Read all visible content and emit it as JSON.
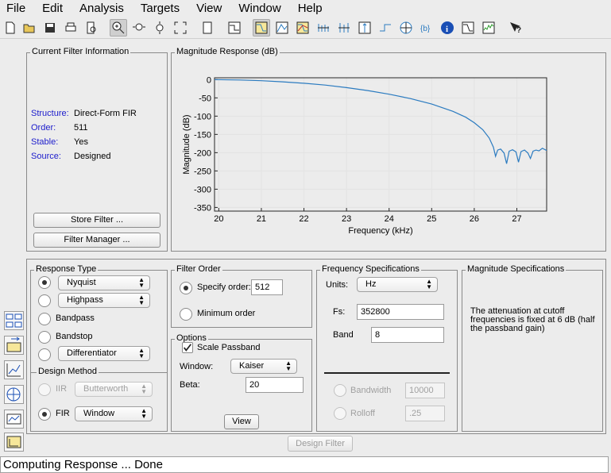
{
  "menubar": {
    "items": [
      "File",
      "Edit",
      "Analysis",
      "Targets",
      "View",
      "Window",
      "Help"
    ]
  },
  "current_filter": {
    "title": "Current Filter Information",
    "structure_label": "Structure:",
    "structure_value": "Direct-Form FIR",
    "order_label": "Order:",
    "order_value": "511",
    "stable_label": "Stable:",
    "stable_value": "Yes",
    "source_label": "Source:",
    "source_value": "Designed",
    "store_button": "Store Filter ...",
    "manager_button": "Filter Manager ..."
  },
  "chart_panel": {
    "title": "Magnitude Response (dB)"
  },
  "chart_data": {
    "type": "line",
    "title": "",
    "xlabel": "Frequency (kHz)",
    "ylabel": "Magnitude (dB)",
    "xlim": [
      19.9,
      27.7
    ],
    "ylim": [
      -360,
      5
    ],
    "xticks": [
      20,
      21,
      22,
      23,
      24,
      25,
      26,
      27
    ],
    "yticks": [
      0,
      -50,
      -100,
      -150,
      -200,
      -250,
      -300,
      -350
    ],
    "grid": true,
    "line_color": "#2b7bc0",
    "series": [
      {
        "x": [
          19.9,
          20.5,
          21.0,
          21.5,
          22.0,
          22.5,
          23.0,
          23.5,
          24.0,
          24.5,
          25.0,
          25.5,
          25.8,
          26.0,
          26.2,
          26.35,
          26.45,
          26.5,
          26.55,
          26.62,
          26.7,
          26.76,
          26.82,
          26.9,
          26.98,
          27.04,
          27.1,
          27.18,
          27.26,
          27.32,
          27.38,
          27.45,
          27.52,
          27.6,
          27.7
        ],
        "y": [
          0,
          -1,
          -3,
          -6,
          -10,
          -15,
          -22,
          -30,
          -40,
          -52,
          -67,
          -87,
          -103,
          -118,
          -137,
          -160,
          -185,
          -210,
          -193,
          -190,
          -201,
          -230,
          -196,
          -192,
          -198,
          -226,
          -197,
          -193,
          -201,
          -216,
          -196,
          -193,
          -195,
          -188,
          -194
        ]
      }
    ]
  },
  "response_type": {
    "title": "Response Type",
    "options": [
      {
        "label": "Nyquist",
        "selected": true,
        "popup": true
      },
      {
        "label": "Highpass",
        "selected": false,
        "popup": true
      },
      {
        "label": "Bandpass",
        "selected": false,
        "popup": false
      },
      {
        "label": "Bandstop",
        "selected": false,
        "popup": false
      },
      {
        "label": "Differentiator",
        "selected": false,
        "popup": true
      }
    ]
  },
  "design_method": {
    "title": "Design Method",
    "iir_label": "IIR",
    "iir_popup": "Butterworth",
    "fir_label": "FIR",
    "fir_popup": "Window"
  },
  "filter_order": {
    "title": "Filter Order",
    "specify_label": "Specify order:",
    "specify_value": "512",
    "minimum_label": "Minimum order"
  },
  "options": {
    "title": "Options",
    "scale_passband_label": "Scale Passband",
    "window_label": "Window:",
    "window_value": "Kaiser",
    "beta_label": "Beta:",
    "beta_value": "20",
    "view_button": "View"
  },
  "freq_specs": {
    "title": "Frequency Specifications",
    "units_label": "Units:",
    "units_value": "Hz",
    "fs_label": "Fs:",
    "fs_value": "352800",
    "band_label": "Band",
    "band_value": "8",
    "bandwidth_label": "Bandwidth",
    "bandwidth_value": "10000",
    "rolloff_label": "Rolloff",
    "rolloff_value": ".25"
  },
  "mag_specs": {
    "title": "Magnitude Specifications",
    "note": "The attenuation at cutoff frequencies is fixed at 6 dB (half the passband gain)"
  },
  "design_button": "Design Filter",
  "status": "Computing Response ... Done"
}
